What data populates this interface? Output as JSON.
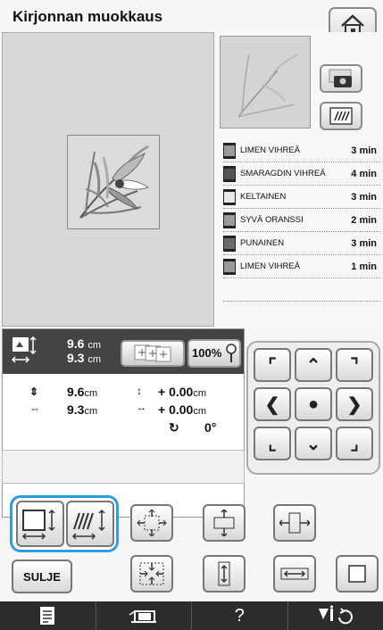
{
  "title": "Kirjonnan muokkaus",
  "threads": [
    {
      "name": "LIMEN VIHREÄ",
      "time": "3 min",
      "color": "#9a9a9a"
    },
    {
      "name": "SMARAGDIN VIHREÄ",
      "time": "4 min",
      "color": "#555555"
    },
    {
      "name": "KELTAINEN",
      "time": "3 min",
      "color": "#e8e8e8"
    },
    {
      "name": "SYVÄ ORANSSI",
      "time": "2 min",
      "color": "#9b9b9b"
    },
    {
      "name": "PUNAINEN",
      "time": "3 min",
      "color": "#6a6a6a"
    },
    {
      "name": "LIMEN VIHREÄ",
      "time": "1 min",
      "color": "#9a9a9a"
    }
  ],
  "size_bar": {
    "height": "9.6",
    "width": "9.3",
    "unit": "cm",
    "zoom": "100%"
  },
  "data": {
    "height": "9.6",
    "width": "9.3",
    "unit": "cm",
    "offset_v": "+ 0.00",
    "offset_h": "+ 0.00",
    "rotation": "0°"
  },
  "buttons": {
    "close_label": "SULJE"
  },
  "colors": {
    "selected_outline": "#2f9ee0",
    "bottom_bar": "#2c2c2c"
  }
}
